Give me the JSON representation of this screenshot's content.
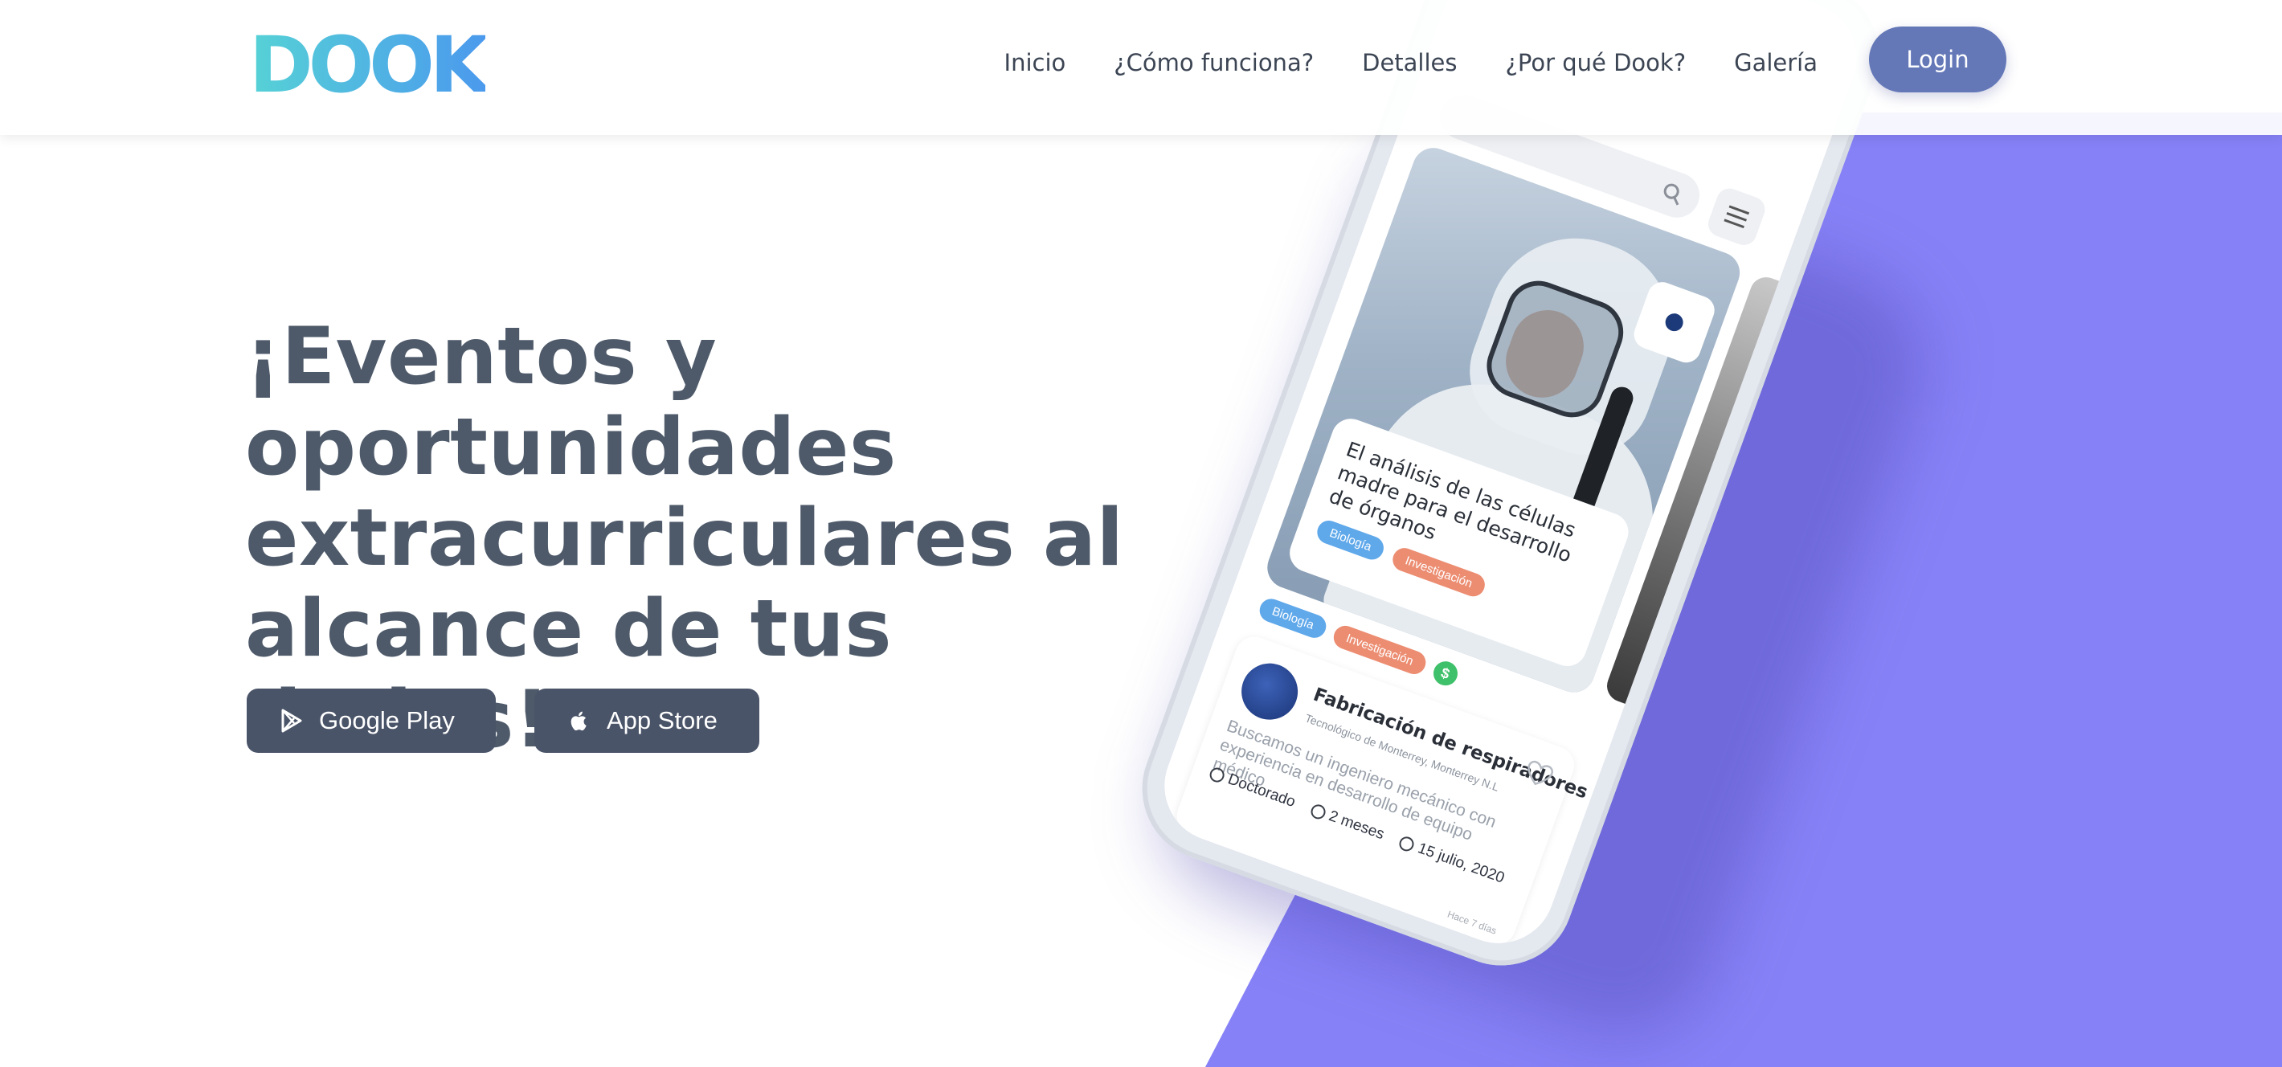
{
  "brand": {
    "logo_text": "DOOK",
    "colors": {
      "logo_start": "#56d2d6",
      "logo_end": "#4b98ee",
      "purple": "#8681f6",
      "login": "#6478b8",
      "dark_button": "#4a5468"
    }
  },
  "nav": {
    "items": [
      {
        "label": "Inicio"
      },
      {
        "label": "¿Cómo funciona?"
      },
      {
        "label": "Detalles"
      },
      {
        "label": "¿Por qué Dook?"
      },
      {
        "label": "Galería"
      }
    ],
    "login_label": "Login"
  },
  "hero": {
    "title": "¡Eventos y oportunidades extracurriculares al alcance de tus dedos!",
    "buttons": {
      "google_play": {
        "label": "Google Play",
        "icon": "google-play-icon"
      },
      "app_store": {
        "label": "App Store",
        "icon": "apple-icon"
      }
    }
  },
  "phone_screen": {
    "featured_card": {
      "title": "El análisis de las células madre para el desarrollo de órganos",
      "tags": [
        "Biología",
        "Investigación"
      ]
    },
    "list_tags": [
      "Biología",
      "Investigación"
    ],
    "money_badge": "$",
    "job": {
      "title": "Fabricación de respiradores",
      "institution": "Tecnológico de Monterrey, Monterrey N.L",
      "description": "Buscamos un ingeniero mecánico con experiencia en desarrollo de equipo médico",
      "level": "Doctorado",
      "duration": "2 meses",
      "date": "15 julio, 2020",
      "posted": "Hace 7 días"
    }
  }
}
